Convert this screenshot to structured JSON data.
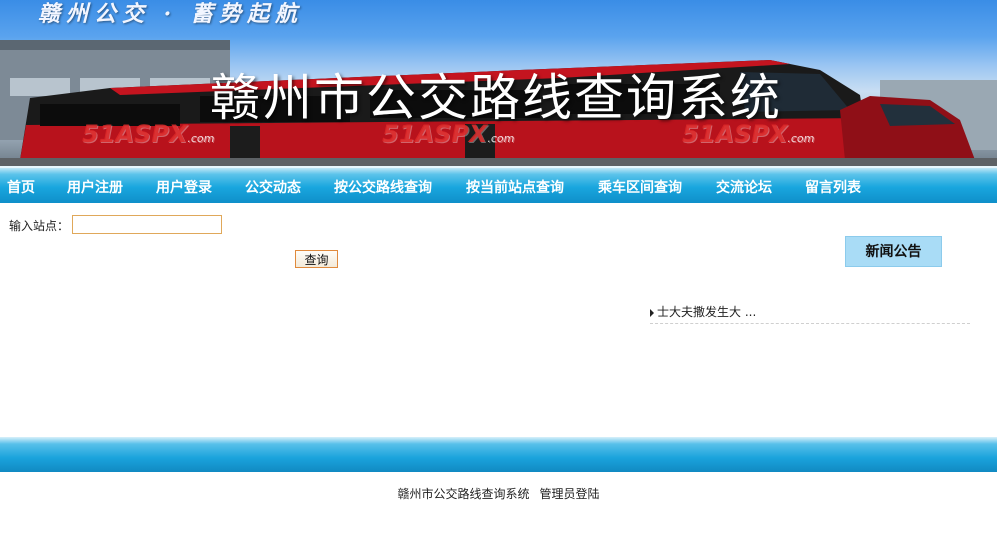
{
  "banner": {
    "slogan": "赣州公交 · 蓄势起航",
    "title": "赣州市公交路线查询系统",
    "watermark": "51ASPX",
    "watermark_suffix": ".com"
  },
  "nav": {
    "items": [
      {
        "label": "首页"
      },
      {
        "label": "用户注册"
      },
      {
        "label": "用户登录"
      },
      {
        "label": "公交动态"
      },
      {
        "label": "按公交路线查询"
      },
      {
        "label": "按当前站点查询"
      },
      {
        "label": "乘车区间查询"
      },
      {
        "label": "交流论坛"
      },
      {
        "label": "留言列表"
      }
    ]
  },
  "search": {
    "label": "输入站点：",
    "value": "",
    "button": "查询"
  },
  "news": {
    "heading": "新闻公告",
    "items": [
      {
        "title": "士大夫撒发生大 ..."
      }
    ]
  },
  "footer": {
    "system_name": "赣州市公交路线查询系统",
    "admin_login": "管理员登陆"
  },
  "colors": {
    "nav_blue": "#19a6de",
    "news_head_bg": "#a9dcf6",
    "button_border": "#e08a3c"
  }
}
